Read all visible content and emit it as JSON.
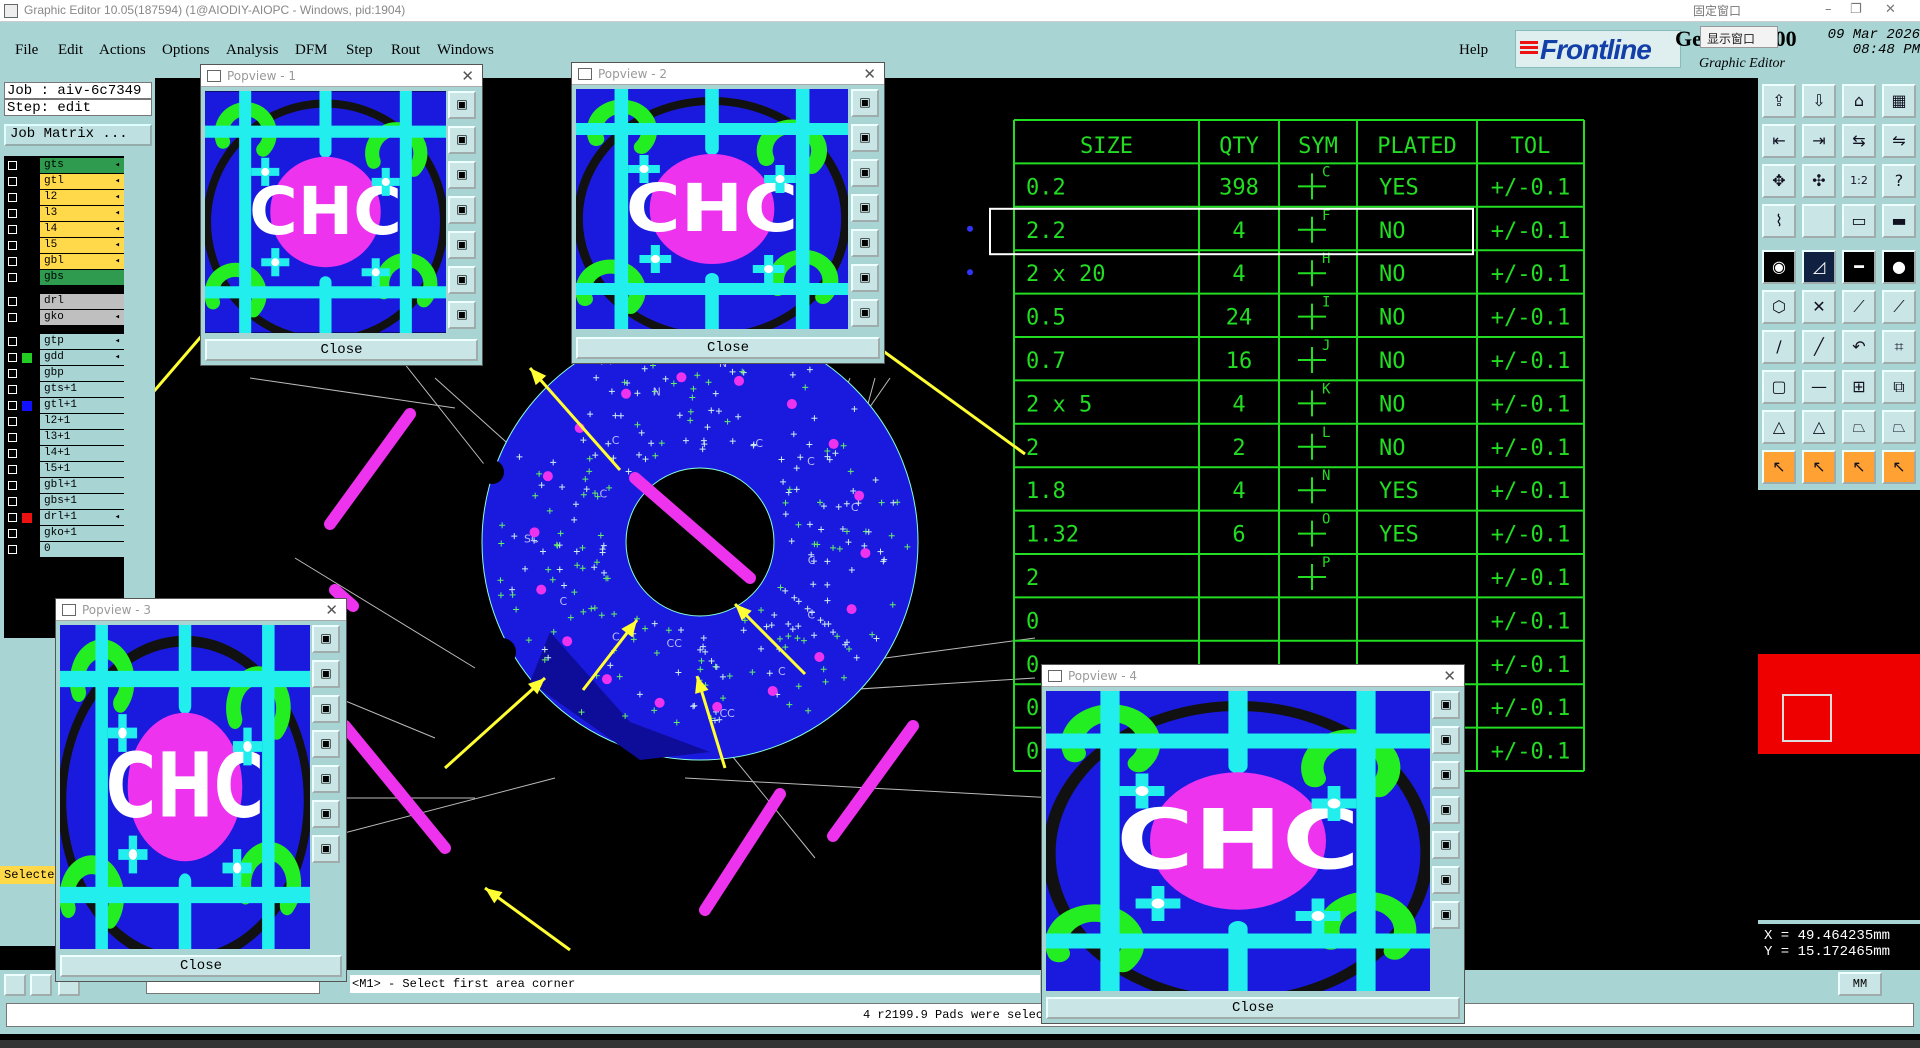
{
  "window": {
    "title": "Graphic Editor 10.05(187594) (1@AIODIY-AIOPC - Windows, pid:1904)",
    "tray_label": "固定窗口",
    "popup_menu_item": "显示窗口",
    "controls": [
      "–",
      "❐",
      "✕"
    ]
  },
  "menu": {
    "items": [
      "File",
      "Edit",
      "Actions",
      "Options",
      "Analysis",
      "DFM",
      "Step",
      "Rout",
      "Windows"
    ],
    "help": "Help"
  },
  "brand": {
    "logo_text": "Frontline",
    "product": "Genesis 2000",
    "subtitle": "Graphic Editor",
    "date": "09 Mar 2026",
    "time": "08:48 PM",
    "accent": "#123fa8",
    "logo_red": "#e11111"
  },
  "job": {
    "job_line": "Job : aiv-6c7349",
    "step_line": "Step: edit",
    "matrix_button": "Job Matrix ..."
  },
  "layers": {
    "group1": [
      {
        "name": "gts",
        "color": "#2e9b4e"
      },
      {
        "name": "gtl",
        "color": "#ffd94a"
      },
      {
        "name": "l2",
        "color": "#ffd94a"
      },
      {
        "name": "l3",
        "color": "#ffd94a"
      },
      {
        "name": "l4",
        "color": "#ffd94a"
      },
      {
        "name": "l5",
        "color": "#ffd94a"
      },
      {
        "name": "gbl",
        "color": "#ffd94a"
      },
      {
        "name": "gbs",
        "color": "#2e9b4e"
      }
    ],
    "group2": [
      {
        "name": "drl",
        "color": "#bfbfbf"
      },
      {
        "name": "gko",
        "color": "#bfbfbf"
      }
    ],
    "group3": [
      {
        "name": "gtp",
        "color": "#a8d4d4",
        "swatch": ""
      },
      {
        "name": "gdd",
        "color": "#a8d4d4",
        "swatch": "#22cc22"
      },
      {
        "name": "gbp",
        "color": "#a8d4d4",
        "swatch": ""
      },
      {
        "name": "gts+1",
        "color": "#a8d4d4",
        "swatch": ""
      },
      {
        "name": "gtl+1",
        "color": "#a8d4d4",
        "swatch": "#1111ff"
      },
      {
        "name": "l2+1",
        "color": "#a8d4d4",
        "swatch": ""
      },
      {
        "name": "l3+1",
        "color": "#a8d4d4",
        "swatch": ""
      },
      {
        "name": "l4+1",
        "color": "#a8d4d4",
        "swatch": ""
      },
      {
        "name": "l5+1",
        "color": "#a8d4d4",
        "swatch": ""
      },
      {
        "name": "gbl+1",
        "color": "#a8d4d4",
        "swatch": ""
      },
      {
        "name": "gbs+1",
        "color": "#a8d4d4",
        "swatch": ""
      },
      {
        "name": "drl+1",
        "color": "#a8d4d4",
        "swatch": "#ee1111"
      },
      {
        "name": "gko+1",
        "color": "#a8d4d4",
        "swatch": ""
      },
      {
        "name": "0",
        "color": "#a8d4d4",
        "swatch": ""
      }
    ],
    "select_label": "Selecte"
  },
  "drill_table": {
    "headers": [
      "SIZE",
      "QTY",
      "SYM",
      "PLATED",
      "TOL"
    ],
    "rows": [
      {
        "size": "0.2",
        "qty": "398",
        "sym": "C",
        "plated": "YES",
        "tol": "+/-0.1"
      },
      {
        "size": "2.2",
        "qty": "4",
        "sym": "F",
        "plated": "NO",
        "tol": "+/-0.1"
      },
      {
        "size": "2 x 20",
        "qty": "4",
        "sym": "H",
        "plated": "NO",
        "tol": "+/-0.1"
      },
      {
        "size": "0.5",
        "qty": "24",
        "sym": "I",
        "plated": "NO",
        "tol": "+/-0.1"
      },
      {
        "size": "0.7",
        "qty": "16",
        "sym": "J",
        "plated": "NO",
        "tol": "+/-0.1"
      },
      {
        "size": "2 x 5",
        "qty": "4",
        "sym": "K",
        "plated": "NO",
        "tol": "+/-0.1"
      },
      {
        "size": "2",
        "qty": "2",
        "sym": "L",
        "plated": "NO",
        "tol": "+/-0.1"
      },
      {
        "size": "1.8",
        "qty": "4",
        "sym": "N",
        "plated": "YES",
        "tol": "+/-0.1"
      },
      {
        "size": "1.32",
        "qty": "6",
        "sym": "O",
        "plated": "YES",
        "tol": "+/-0.1"
      },
      {
        "size": "2",
        "qty": "",
        "sym": "P",
        "plated": "",
        "tol": "+/-0.1"
      },
      {
        "size": "0",
        "qty": "",
        "sym": "",
        "plated": "",
        "tol": "+/-0.1"
      },
      {
        "size": "0",
        "qty": "",
        "sym": "",
        "plated": "",
        "tol": "+/-0.1"
      },
      {
        "size": "0",
        "qty": "",
        "sym": "",
        "plated": "",
        "tol": "+/-0.1"
      },
      {
        "size": "0",
        "qty": "",
        "sym": "",
        "plated": "",
        "tol": "+/-0.1"
      }
    ],
    "highlighted_row": 1,
    "line_color": "#22dd22"
  },
  "popviews": [
    {
      "title": "Popview - 1",
      "close": "Close"
    },
    {
      "title": "Popview - 2",
      "close": "Close"
    },
    {
      "title": "Popview - 3",
      "close": "Close"
    },
    {
      "title": "Popview - 4",
      "close": "Close"
    }
  ],
  "popview_zoom_label": "CHC",
  "board_marks": [
    "C",
    "C",
    "C",
    "CC",
    "CC",
    "C",
    "C",
    "SC",
    "C",
    "C",
    "N",
    "N",
    "C",
    "C",
    "C"
  ],
  "command": {
    "prompt": "<M1> - Select first area corner",
    "units": "MM"
  },
  "status": {
    "message": "4 r2199.9 Pads were select"
  },
  "coordinates": {
    "x": "X = 49.464235mm",
    "y": "Y = 15.172465mm"
  },
  "colors": {
    "panel": "#a8d4d4",
    "board_blue": "#1a1adf",
    "pad_magenta": "#ee33ee",
    "trace_cyan": "#22eeee",
    "arrow_yellow": "#ffff33",
    "selection_red": "#e00000"
  },
  "toolbar_icons": [
    "home-icon",
    "save-icon",
    "house-icon",
    "grid-icon",
    "arrow-left-icon",
    "arrow-right-icon",
    "swap-icon",
    "split-icon",
    "zoom-fit-icon",
    "zoom-window-icon",
    "scale-icon",
    "help-icon",
    "snap-icon",
    "blank-icon",
    "measure-icon",
    "measure-alt-icon",
    "camera-icon",
    "angle-icon",
    "ruler-icon",
    "dot-icon",
    "node-icon",
    "cross-icon",
    "link-icon",
    "link-alt-icon",
    "line-icon",
    "pen-icon",
    "arc-icon",
    "route-icon",
    "rect-icon",
    "minus-icon",
    "bracket-icon",
    "layers-icon",
    "triangle-icon",
    "triangle-alt-icon",
    "trapezoid-icon",
    "trapezoid-alt-icon",
    "pointer-icon",
    "pointer-red-icon",
    "pointer-outline-icon",
    "pointer-multi-icon"
  ]
}
